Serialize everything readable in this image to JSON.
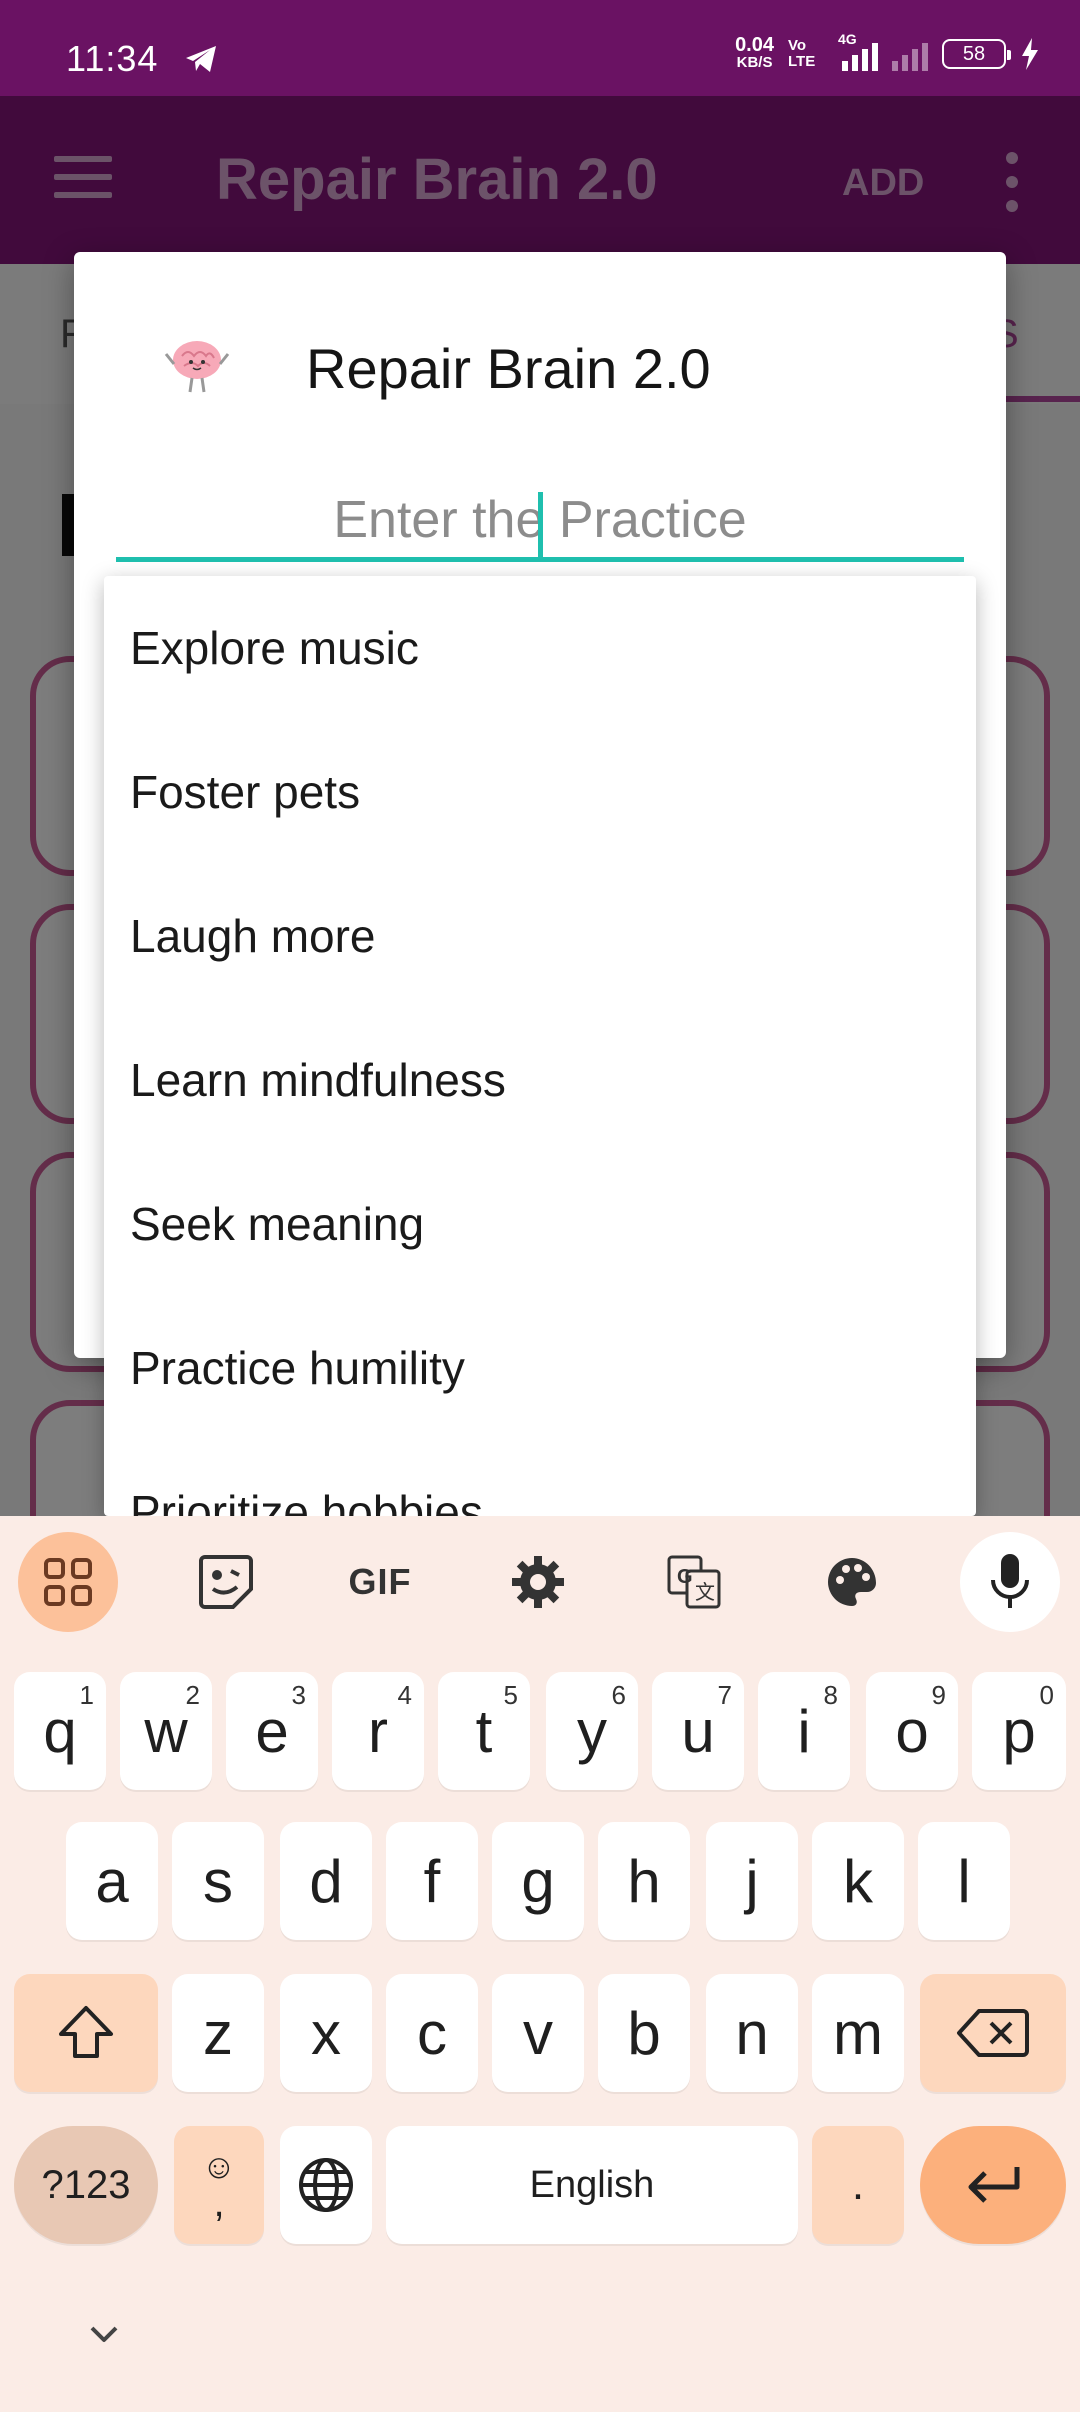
{
  "status_bar": {
    "time": "11:34",
    "net_speed": "0.04",
    "net_unit": "KB/S",
    "volte": "Vo LTE",
    "network": "4G",
    "battery": "58"
  },
  "app_bar": {
    "title": "Repair Brain 2.0",
    "add_label": "ADD",
    "color": "#831478"
  },
  "background": {
    "tab_left_fragment": "F",
    "tab_right_fragment": "S"
  },
  "dialog": {
    "title": "Repair Brain 2.0",
    "input_placeholder": "Enter the Practice",
    "input_value": "",
    "accent_color": "#1fbfae"
  },
  "dropdown": {
    "items": [
      "Explore music",
      "Foster pets",
      "Laugh more",
      "Learn mindfulness",
      "Seek meaning",
      "Practice humility",
      "Prioritize hobbies"
    ]
  },
  "keyboard": {
    "toolbar": {
      "gif_label": "GIF",
      "icons": [
        "apps-icon",
        "sticker-icon",
        "gif-icon",
        "settings-icon",
        "translate-icon",
        "palette-icon",
        "mic-icon"
      ]
    },
    "row1": [
      {
        "k": "q",
        "h": "1"
      },
      {
        "k": "w",
        "h": "2"
      },
      {
        "k": "e",
        "h": "3"
      },
      {
        "k": "r",
        "h": "4"
      },
      {
        "k": "t",
        "h": "5"
      },
      {
        "k": "y",
        "h": "6"
      },
      {
        "k": "u",
        "h": "7"
      },
      {
        "k": "i",
        "h": "8"
      },
      {
        "k": "o",
        "h": "9"
      },
      {
        "k": "p",
        "h": "0"
      }
    ],
    "row2": [
      "a",
      "s",
      "d",
      "f",
      "g",
      "h",
      "j",
      "k",
      "l"
    ],
    "row3": [
      "z",
      "x",
      "c",
      "v",
      "b",
      "n",
      "m"
    ],
    "symbols_label": "?123",
    "emoji_top": "☺",
    "emoji_bottom": ",",
    "space_label": "English",
    "period_label": "."
  }
}
